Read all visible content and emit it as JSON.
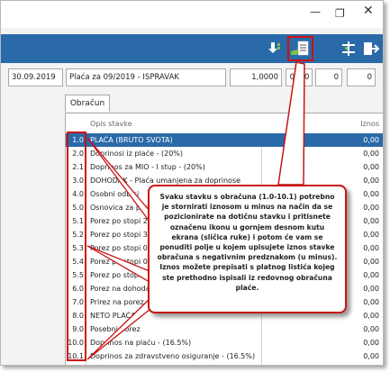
{
  "header": {
    "date": "30.09.2019",
    "title": "Plaća za 09/2019 - ISPRAVAK",
    "rate": "1,0000",
    "field_a": "0",
    "field_b": "0",
    "field_c": "0",
    "field_d": "0"
  },
  "tabs": [
    {
      "label": "Obračun"
    }
  ],
  "columns": {
    "description": "Opis stavke",
    "amount": "Iznos"
  },
  "rows": [
    {
      "code": "1.0",
      "desc": "PLAĆA (BRUTO SVOTA)",
      "amount": "0,00"
    },
    {
      "code": "2.0",
      "desc": "Doprinosi iz plaće - (20%)",
      "amount": "0,00"
    },
    {
      "code": "2.1",
      "desc": "Doprinos za MIO - I stup - (20%)",
      "amount": "0,00"
    },
    {
      "code": "3.0",
      "desc": "DOHODAK - Plaća umanjena za doprinose",
      "amount": "0,00"
    },
    {
      "code": "4.0",
      "desc": "Osobni odbici",
      "amount": "0,00"
    },
    {
      "code": "5.0",
      "desc": "Osnovica za porez",
      "amount": "0,00"
    },
    {
      "code": "5.1",
      "desc": "Porez po stopi 24%",
      "amount": "0,00"
    },
    {
      "code": "5.2",
      "desc": "Porez po stopi 36%",
      "amount": "0,00"
    },
    {
      "code": "5.3",
      "desc": "Porez po stopi 0%",
      "amount": "0,00"
    },
    {
      "code": "5.4",
      "desc": "Porez po stopi 0%",
      "amount": "0,00"
    },
    {
      "code": "5.5",
      "desc": "Porez po stopi",
      "amount": "0,00"
    },
    {
      "code": "6.0",
      "desc": "Porez na dohodak",
      "amount": "0,00"
    },
    {
      "code": "7.0",
      "desc": "Prirez na porez po",
      "amount": "0,00"
    },
    {
      "code": "8.0",
      "desc": "NETO PLAĆA",
      "amount": "0,00"
    },
    {
      "code": "9.0",
      "desc": "Posebni porez",
      "amount": "0,00"
    },
    {
      "code": "10.0",
      "desc": "Doprinos na plaću - (16.5%)",
      "amount": "0,00"
    },
    {
      "code": "10.1",
      "desc": "Doprinos za zdravstveno osiguranje - (16.5%)",
      "amount": "0,00"
    }
  ],
  "callout": "Svaku stavku s obračuna (1.0-10.1) potrebno je stornirati iznosom u minus na način da se pozicionirate na dotičnu stavku i pritisnete označenu ikonu u gornjem desnom kutu ekrana (sličica ruke) i potom će vam se ponuditi polje u kojem upisujete iznos stavke obračuna s negativnim predznakom (u minus). Iznos možete prepisati s platnog listića kojeg ste prethodno ispisali iz redovnog obračuna plaće.",
  "colors": {
    "toolbar": "#2a6aa8",
    "highlight": "#d01010",
    "accent_green": "#7cc24a"
  }
}
